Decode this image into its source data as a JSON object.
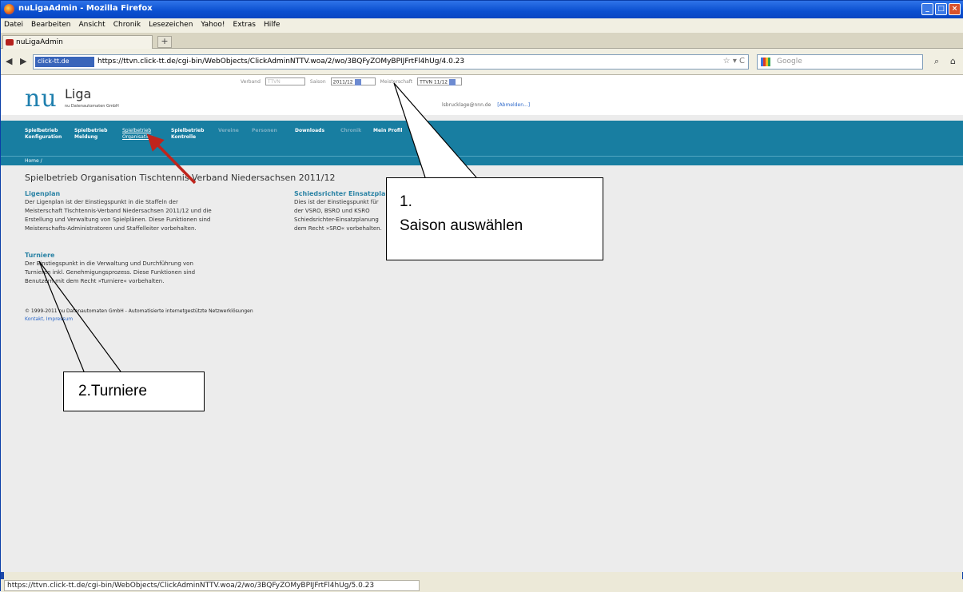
{
  "window": {
    "title": "nuLigaAdmin - Mozilla Firefox",
    "controls": [
      "_",
      "□",
      "×"
    ]
  },
  "menu": [
    "Datei",
    "Bearbeiten",
    "Ansicht",
    "Chronik",
    "Lesezeichen",
    "Yahoo!",
    "Extras",
    "Hilfe"
  ],
  "tab": {
    "label": "nuLigaAdmin",
    "new_tab": "+"
  },
  "nav": {
    "back": "◀",
    "forward": "▶",
    "identity": "click-tt.de",
    "url": "https://ttvn.click-tt.de/cgi-bin/WebObjects/ClickAdminNTTV.woa/2/wo/3BQFyZOMyBPIJFrtFl4hUg/4.0.23",
    "url_buttons": "☆ ▾ C",
    "search_placeholder": "Google",
    "search_button": "⌕",
    "home_button": "⌂"
  },
  "header": {
    "logo_nu": "nu",
    "logo_liga": "Liga",
    "logo_sub": "nu Datenautomaten GmbH",
    "verband_label": "Verband",
    "verband_value": "TTVN",
    "saison_label": "Saison",
    "saison_value": "2011/12",
    "meisterschaft_label": "Meisterschaft",
    "meisterschaft_value": "TTVN 11/12",
    "user_email": "lsbrucklage@nnn.de",
    "logout": "[Abmelden...]"
  },
  "mainnav": [
    {
      "line1": "Spielbetrieb",
      "line2": "Konfiguration"
    },
    {
      "line1": "Spielbetrieb",
      "line2": "Meldung"
    },
    {
      "line1": "Spielbetrieb",
      "line2": "Organisation"
    },
    {
      "line1": "Spielbetrieb",
      "line2": "Kontrolle"
    },
    {
      "line1": "Vereine",
      "line2": ""
    },
    {
      "line1": "Personen",
      "line2": ""
    },
    {
      "line1": "Downloads",
      "line2": ""
    },
    {
      "line1": "Chronik",
      "line2": ""
    },
    {
      "line1": "Mein Profil",
      "line2": ""
    }
  ],
  "breadcrumb": "Home /",
  "page": {
    "title": "Spielbetrieb Organisation Tischtennis-Verband Niedersachsen 2011/12",
    "sections": [
      {
        "heading": "Ligenplan",
        "lines": [
          "Der Ligenplan ist der Einstiegspunkt in die Staffeln der",
          "Meisterschaft Tischtennis-Verband Niedersachsen 2011/12 und die",
          "Erstellung und Verwaltung von Spielplänen. Diese Funktionen sind",
          "Meisterschafts-Administratoren und Staffelleiter vorbehalten."
        ]
      },
      {
        "heading": "Schiedsrichter Einsatzplanung",
        "lines": [
          "Dies ist der Einstiegspunkt für",
          "der VSRO, BSRO und KSRO",
          "Schiedsrichter-Einsatzplanung",
          "dem Recht »SRO« vorbehalten."
        ]
      },
      {
        "heading": "Turniere",
        "lines": [
          "Der Einstiegspunkt in die Verwaltung und Durchführung von",
          "Turnieren inkl. Genehmigungsprozess. Diese Funktionen sind",
          "Benutzern mit dem Recht »Turniere« vorbehalten."
        ]
      }
    ],
    "footer_copyright": "© 1999-2011 nu Datenautomaten GmbH - Automatisierte internetgestützte Netzwerklösungen",
    "footer_links": "Kontakt, Impressum"
  },
  "annotations": {
    "callout1_line1": "1.",
    "callout1_line2": "Saison auswählen",
    "callout2": "2.Turniere"
  },
  "status_text": "https://ttvn.click-tt.de/cgi-bin/WebObjects/ClickAdminNTTV.woa/2/wo/3BQFyZOMyBPIJFrtFl4hUg/5.0.23",
  "colors": {
    "nav_teal": "#187ea1",
    "link_blue": "#2b83a5",
    "arrow_red": "#c0241c"
  }
}
